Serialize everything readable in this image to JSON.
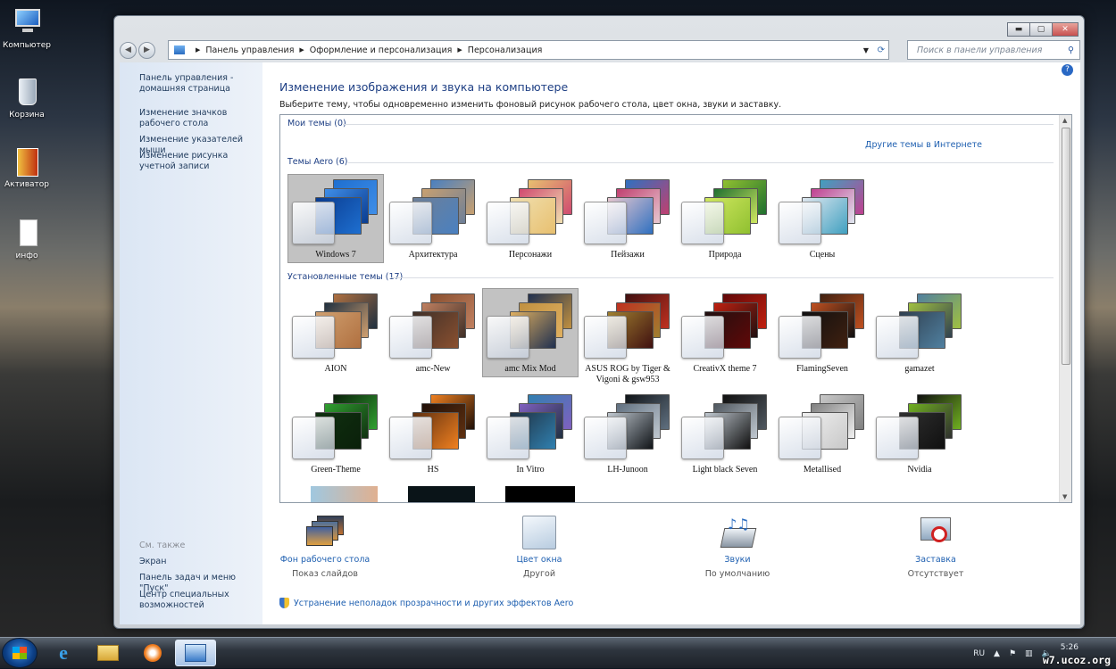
{
  "desktop": {
    "icons": [
      {
        "label": "Компьютер"
      },
      {
        "label": "Корзина"
      },
      {
        "label": "Активатор"
      },
      {
        "label": "инфо"
      }
    ]
  },
  "window": {
    "caption_buttons": {
      "minimize": "▬",
      "maximize": "▢",
      "close": "✕"
    },
    "breadcrumb": [
      "Панель управления",
      "Оформление и персонализация",
      "Персонализация"
    ],
    "search_placeholder": "Поиск в панели управления"
  },
  "sidebar": {
    "links": [
      {
        "label": "Панель управления - домашняя страница"
      },
      {
        "label": "Изменение значков рабочего стола"
      },
      {
        "label": "Изменение указателей мыши"
      },
      {
        "label": "Изменение рисунка учетной записи"
      }
    ],
    "see_also_title": "См. также",
    "see_also": [
      {
        "label": "Экран"
      },
      {
        "label": "Панель задач и меню \"Пуск\""
      },
      {
        "label": "Центр специальных возможностей"
      }
    ]
  },
  "main": {
    "title": "Изменение изображения и звука на компьютере",
    "subtitle": "Выберите тему, чтобы одновременно изменить фоновый рисунок рабочего стола, цвет окна, звуки и заставку.",
    "my_themes": "Мои темы (0)",
    "more_themes": "Другие темы в Интернете",
    "aero_group": "Темы Aero (6)",
    "installed_group": "Установленные темы (17)",
    "aero_themes": [
      {
        "name": "Windows 7",
        "selected": true,
        "colors": [
          "#1e6fd0",
          "#3f8ee8",
          "#0a3c90"
        ]
      },
      {
        "name": "Архитектура",
        "colors": [
          "#4a80c0",
          "#c8a070",
          "#6d7f98"
        ]
      },
      {
        "name": "Персонажи",
        "colors": [
          "#e8c070",
          "#d04a70",
          "#f0e0b0"
        ]
      },
      {
        "name": "Пейзажи",
        "colors": [
          "#3070c0",
          "#c04070",
          "#e8c8d0"
        ]
      },
      {
        "name": "Природа",
        "colors": [
          "#90c030",
          "#207030",
          "#d0e860"
        ]
      },
      {
        "name": "Сцены",
        "colors": [
          "#40a0c0",
          "#c04090",
          "#e0e8f0"
        ]
      }
    ],
    "installed_themes": [
      {
        "name": "AION",
        "colors": [
          "#b07040",
          "#203040",
          "#d0a070"
        ]
      },
      {
        "name": "amc-New",
        "colors": [
          "#8a5030",
          "#c08060",
          "#403028"
        ]
      },
      {
        "name": "amc Mix Mod",
        "selected": true,
        "colors": [
          "#203050",
          "#c09040",
          "#e0b060"
        ]
      },
      {
        "name": "ASUS ROG by Tiger & Vigoni & gsw953",
        "colors": [
          "#401010",
          "#c03020",
          "#a08030"
        ]
      },
      {
        "name": "CreativX theme 7",
        "colors": [
          "#600808",
          "#c02010",
          "#201010"
        ]
      },
      {
        "name": "FlamingSeven",
        "colors": [
          "#402010",
          "#c05020",
          "#101010"
        ]
      },
      {
        "name": "gamazet",
        "colors": [
          "#5080a0",
          "#a0c040",
          "#304050"
        ]
      },
      {
        "name": "Green-Theme",
        "colors": [
          "#0a200a",
          "#30a030",
          "#103010"
        ]
      },
      {
        "name": "HS",
        "colors": [
          "#f08020",
          "#201008",
          "#603010"
        ]
      },
      {
        "name": "In Vitro",
        "colors": [
          "#3080b0",
          "#8060c0",
          "#203040"
        ]
      },
      {
        "name": "LH-Junoon",
        "colors": [
          "#101418",
          "#607080",
          "#c0c8d0"
        ]
      },
      {
        "name": "Light black Seven",
        "colors": [
          "#101010",
          "#505860",
          "#c0c8d0"
        ]
      },
      {
        "name": "Metallised",
        "colors": [
          "#c8c8c8",
          "#808080",
          "#f0f0f0"
        ]
      },
      {
        "name": "Nvidia",
        "colors": [
          "#101010",
          "#70b020",
          "#303030"
        ]
      }
    ]
  },
  "bottom": {
    "items": [
      {
        "label": "Фон рабочего стола",
        "value": "Показ слайдов"
      },
      {
        "label": "Цвет окна",
        "value": "Другой"
      },
      {
        "label": "Звуки",
        "value": "По умолчанию"
      },
      {
        "label": "Заставка",
        "value": "Отсутствует"
      }
    ],
    "aero_link": "Устранение неполадок прозрачности и других эффектов Aero"
  },
  "taskbar": {
    "lang": "RU",
    "time": "5:26"
  },
  "watermark": "w7.ucoz.org"
}
